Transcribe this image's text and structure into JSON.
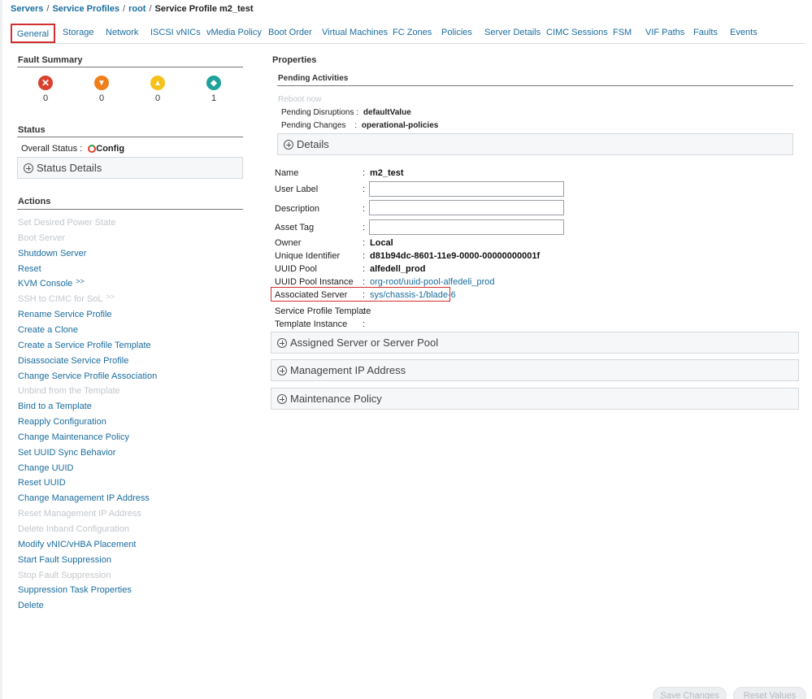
{
  "breadcrumb": {
    "items": [
      "Servers",
      "Service Profiles",
      "root"
    ],
    "current": "Service Profile m2_test"
  },
  "tabs": [
    "General",
    "Storage",
    "Network",
    "ISCSI vNICs",
    "vMedia Policy",
    "Boot Order",
    "Virtual Machines",
    "FC Zones",
    "Policies",
    "Server Details",
    "CIMC Sessions",
    "FSM",
    "VIF Paths",
    "Faults",
    "Events"
  ],
  "active_tab": "General",
  "fault_summary": {
    "title": "Fault Summary",
    "items": [
      {
        "icon": "critical-icon",
        "color": "#d9412c",
        "count": "0"
      },
      {
        "icon": "major-icon",
        "color": "#f07f1b",
        "count": "0"
      },
      {
        "icon": "minor-icon",
        "color": "#f4c21b",
        "count": "0"
      },
      {
        "icon": "warning-icon",
        "color": "#1fa29b",
        "count": "1"
      }
    ]
  },
  "status": {
    "title": "Status",
    "overall_label": "Overall Status :",
    "overall_value": "Config",
    "details_label": "Status Details"
  },
  "actions": {
    "title": "Actions",
    "items": [
      {
        "label": "Set Desired Power State",
        "enabled": false
      },
      {
        "label": "Boot Server",
        "enabled": false
      },
      {
        "label": "Shutdown Server",
        "enabled": true
      },
      {
        "label": "Reset",
        "enabled": true
      },
      {
        "label": "KVM Console",
        "enabled": true,
        "chevron": ">>"
      },
      {
        "label": "SSH to CIMC for SoL",
        "enabled": false,
        "chevron": ">>"
      },
      {
        "label": "Rename Service Profile",
        "enabled": true
      },
      {
        "label": "Create a Clone",
        "enabled": true
      },
      {
        "label": "Create a Service Profile Template",
        "enabled": true
      },
      {
        "label": "Disassociate Service Profile",
        "enabled": true
      },
      {
        "label": "Change Service Profile Association",
        "enabled": true
      },
      {
        "label": "Unbind from the Template",
        "enabled": false
      },
      {
        "label": "Bind to a Template",
        "enabled": true
      },
      {
        "label": "Reapply Configuration",
        "enabled": true
      },
      {
        "label": "Change Maintenance Policy",
        "enabled": true
      },
      {
        "label": "Set UUID Sync Behavior",
        "enabled": true
      },
      {
        "label": "Change UUID",
        "enabled": true
      },
      {
        "label": "Reset UUID",
        "enabled": true
      },
      {
        "label": "Change Management IP Address",
        "enabled": true
      },
      {
        "label": "Reset Management IP Address",
        "enabled": false
      },
      {
        "label": "Delete Inband Configuration",
        "enabled": false
      },
      {
        "label": "Modify vNIC/vHBA Placement",
        "enabled": true
      },
      {
        "label": "Start Fault Suppression",
        "enabled": true
      },
      {
        "label": "Stop Fault Suppression",
        "enabled": false
      },
      {
        "label": "Suppression Task Properties",
        "enabled": true
      },
      {
        "label": "Delete",
        "enabled": true
      }
    ]
  },
  "properties": {
    "title": "Properties",
    "pending": {
      "title": "Pending Activities",
      "reboot_now": "Reboot now",
      "disruptions_label": "Pending Disruptions :",
      "disruptions_value": "defaultValue",
      "changes_label": "Pending Changes",
      "changes_colon": ":",
      "changes_value": "operational-policies",
      "details_label": "Details"
    },
    "name_label": "Name",
    "name_value": "m2_test",
    "user_label_label": "User Label",
    "user_label_value": "",
    "description_label": "Description",
    "description_value": "",
    "asset_tag_label": "Asset Tag",
    "asset_tag_value": "",
    "owner_label": "Owner",
    "owner_value": "Local",
    "uuid_label": "Unique Identifier",
    "uuid_value": "d81b94dc-8601-11e9-0000-00000000001f",
    "uuid_pool_label": "UUID Pool",
    "uuid_pool_value": "alfedell_prod",
    "uuid_pool_instance_label": "UUID Pool Instance",
    "uuid_pool_instance_value": "org-root/uuid-pool-alfedeli_prod",
    "associated_server_label": "Associated Server",
    "associated_server_value": "sys/chassis-1/blade-6",
    "sp_template_label": "Service Profile Template",
    "template_instance_label": "Template Instance",
    "colon": ":"
  },
  "sections": {
    "assigned": "Assigned Server or Server Pool",
    "mgmt_ip": "Management IP Address",
    "maintenance": "Maintenance Policy"
  },
  "footer": {
    "save": "Save Changes",
    "reset": "Reset Values"
  }
}
